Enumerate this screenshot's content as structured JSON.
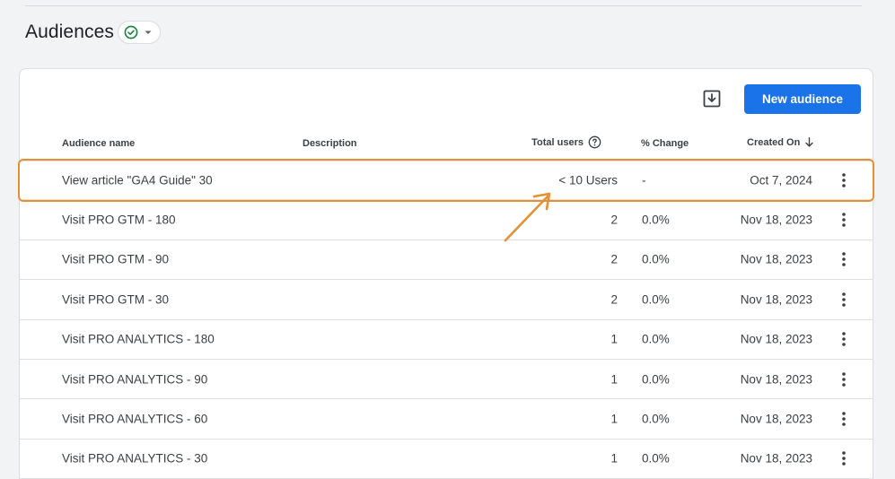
{
  "header": {
    "title": "Audiences"
  },
  "toolbar": {
    "new_audience_label": "New audience"
  },
  "columns": {
    "name": "Audience name",
    "description": "Description",
    "total_users": "Total users",
    "change": "% Change",
    "created_on": "Created On"
  },
  "rows": [
    {
      "name": "View article \"GA4 Guide\" 30",
      "description": "",
      "users": "< 10 Users",
      "change": "-",
      "created": "Oct 7, 2024"
    },
    {
      "name": "Visit PRO GTM - 180",
      "description": "",
      "users": "2",
      "change": "0.0%",
      "created": "Nov 18, 2023"
    },
    {
      "name": "Visit PRO GTM - 90",
      "description": "",
      "users": "2",
      "change": "0.0%",
      "created": "Nov 18, 2023"
    },
    {
      "name": "Visit PRO GTM - 30",
      "description": "",
      "users": "2",
      "change": "0.0%",
      "created": "Nov 18, 2023"
    },
    {
      "name": "Visit PRO ANALYTICS - 180",
      "description": "",
      "users": "1",
      "change": "0.0%",
      "created": "Nov 18, 2023"
    },
    {
      "name": "Visit PRO ANALYTICS - 90",
      "description": "",
      "users": "1",
      "change": "0.0%",
      "created": "Nov 18, 2023"
    },
    {
      "name": "Visit PRO ANALYTICS - 60",
      "description": "",
      "users": "1",
      "change": "0.0%",
      "created": "Nov 18, 2023"
    },
    {
      "name": "Visit PRO ANALYTICS - 30",
      "description": "",
      "users": "1",
      "change": "0.0%",
      "created": "Nov 18, 2023"
    }
  ],
  "icons": {
    "status": "check-circle-icon",
    "dropdown": "caret-down-icon",
    "download": "download-icon",
    "help": "help-circle-icon",
    "sort": "arrow-down-icon",
    "row_menu": "more-vert-icon"
  },
  "colors": {
    "accent": "#1a73e8",
    "status_ok": "#188038",
    "annotation": "#e69035"
  }
}
